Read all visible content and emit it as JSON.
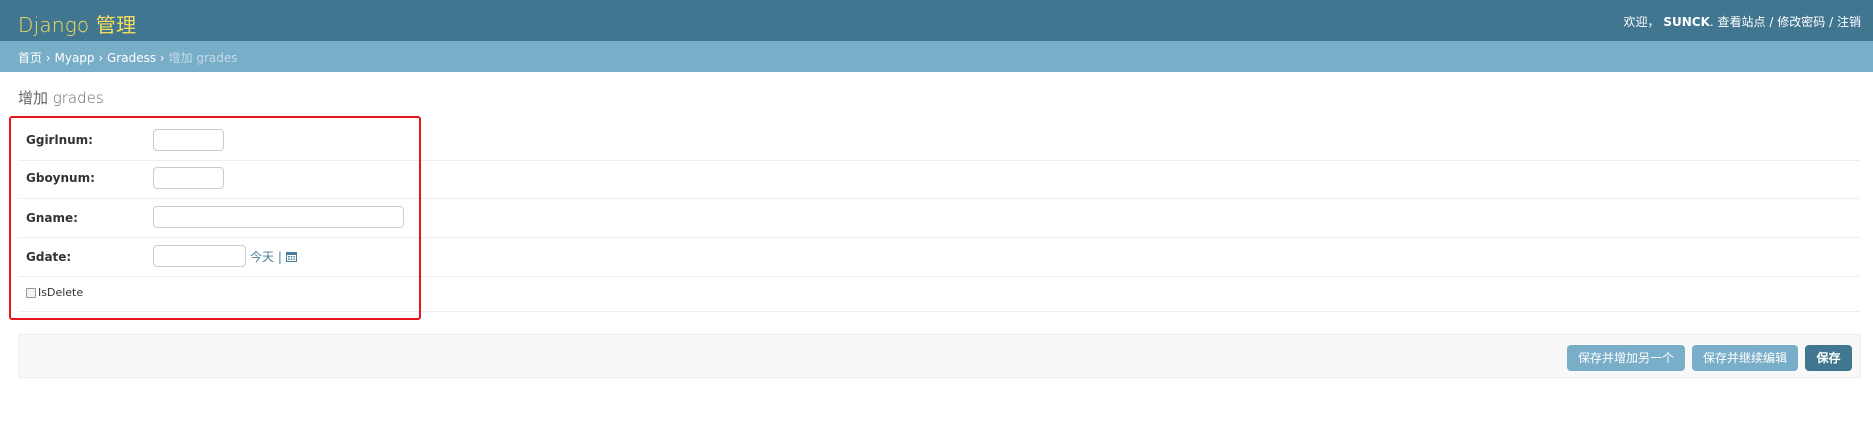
{
  "header": {
    "site_name": "Django 管理",
    "welcome": "欢迎，",
    "username": "SUNCK",
    "period": ".",
    "view_site": "查看站点",
    "sep": "/",
    "change_password": "修改密码",
    "logout": "注销"
  },
  "breadcrumbs": {
    "home": "首页",
    "app": "Myapp",
    "model": "Gradess",
    "current": "增加 grades",
    "sep": "›"
  },
  "page": {
    "title": "增加 grades"
  },
  "form": {
    "fields": [
      {
        "label": "Ggirlnum:",
        "value": ""
      },
      {
        "label": "Gboynum:",
        "value": ""
      },
      {
        "label": "Gname:",
        "value": ""
      },
      {
        "label": "Gdate:",
        "value": ""
      }
    ],
    "date_shortcut": {
      "today": "今天",
      "divider": "|"
    },
    "checkbox": {
      "label": "IsDelete",
      "checked": false
    }
  },
  "actions": {
    "save_add_another": "保存并增加另一个",
    "save_continue": "保存并继续编辑",
    "save": "保存"
  },
  "colors": {
    "header": "#417690",
    "breadcrumbs": "#79aec8",
    "branding": "#f5dd5d",
    "highlight": "#e8161b"
  }
}
